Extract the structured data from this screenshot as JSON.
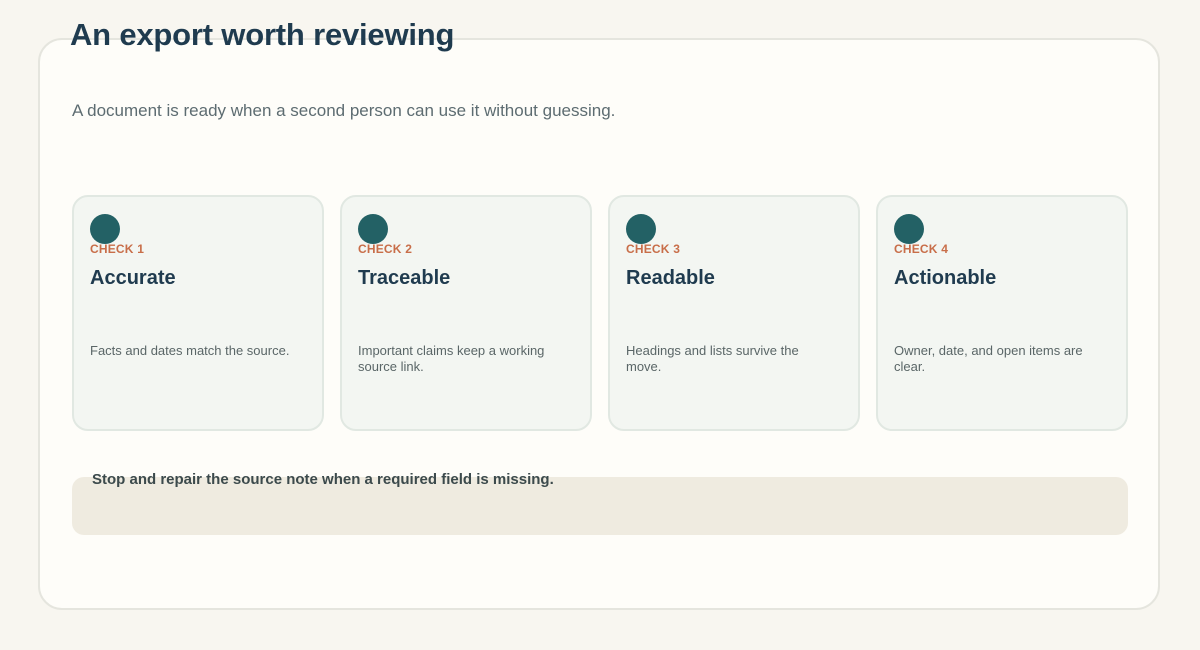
{
  "header": {
    "title": "An export worth reviewing",
    "subtitle": "A document is ready when a second person can use it without guessing."
  },
  "checks": [
    {
      "kicker": "CHECK 1",
      "title": "Accurate",
      "text": "Facts and dates match the source."
    },
    {
      "kicker": "CHECK 2",
      "title": "Traceable",
      "text": "Important claims keep a working source link."
    },
    {
      "kicker": "CHECK 3",
      "title": "Readable",
      "text": "Headings and lists survive the move."
    },
    {
      "kicker": "CHECK 4",
      "title": "Actionable",
      "text": "Owner, date, and open items are clear."
    }
  ],
  "note": {
    "text": "Stop and repair the source note when a required field is missing."
  },
  "colors": {
    "page_background": "#f8f6f0",
    "panel_background": "#fefdf9",
    "card_background": "#f3f6f2",
    "accent_dot": "#236165",
    "kicker": "#c86e49",
    "heading": "#1f3b4f",
    "note_background": "#efebe0"
  },
  "icons": {
    "card_marker": "circle-marker-icon"
  }
}
